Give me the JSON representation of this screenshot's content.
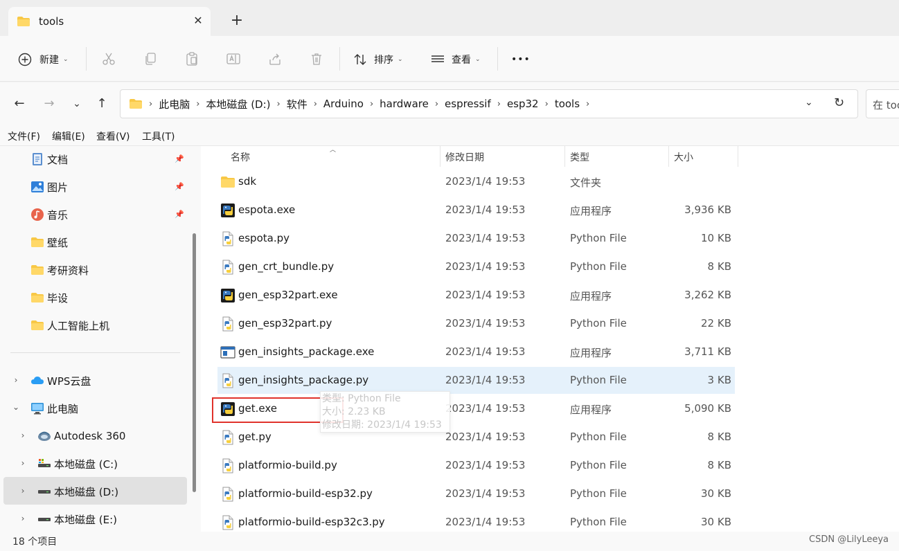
{
  "tab": {
    "title": "tools"
  },
  "toolbar": {
    "new_label": "新建",
    "sort_label": "排序",
    "view_label": "查看",
    "more_label": "•••"
  },
  "address": {
    "crumbs": [
      "此电脑",
      "本地磁盘 (D:)",
      "软件",
      "Arduino",
      "hardware",
      "espressif",
      "esp32",
      "tools"
    ],
    "search_placeholder": "在 tools"
  },
  "menubar": [
    "文件(F)",
    "编辑(E)",
    "查看(V)",
    "工具(T)"
  ],
  "sidebar": {
    "quick": [
      {
        "label": "文档",
        "icon": "document-icon",
        "pinned": true
      },
      {
        "label": "图片",
        "icon": "picture-icon",
        "pinned": true
      },
      {
        "label": "音乐",
        "icon": "music-icon",
        "pinned": true
      },
      {
        "label": "壁纸",
        "icon": "folder-icon",
        "pinned": false
      },
      {
        "label": "考研资料",
        "icon": "folder-icon",
        "pinned": false
      },
      {
        "label": "毕设",
        "icon": "folder-icon",
        "pinned": false
      },
      {
        "label": "人工智能上机",
        "icon": "folder-icon",
        "pinned": false
      }
    ],
    "tree": [
      {
        "label": "WPS云盘",
        "icon": "cloud-icon",
        "expanded": false
      },
      {
        "label": "此电脑",
        "icon": "computer-icon",
        "expanded": true
      },
      {
        "label": "Autodesk 360",
        "icon": "autodesk-icon",
        "expanded": false
      },
      {
        "label": "本地磁盘 (C:)",
        "icon": "drive-icon",
        "expanded": false
      },
      {
        "label": "本地磁盘 (D:)",
        "icon": "drive-icon",
        "expanded": false,
        "selected": true
      },
      {
        "label": "本地磁盘 (E:)",
        "icon": "drive-icon",
        "expanded": false
      }
    ]
  },
  "columns": {
    "name": "名称",
    "date": "修改日期",
    "type": "类型",
    "size": "大小"
  },
  "files": [
    {
      "name": "sdk",
      "date": "2023/1/4 19:53",
      "type": "文件夹",
      "size": "",
      "icon": "folder-icon"
    },
    {
      "name": "espota.exe",
      "date": "2023/1/4 19:53",
      "type": "应用程序",
      "size": "3,936 KB",
      "icon": "python-exe-icon"
    },
    {
      "name": "espota.py",
      "date": "2023/1/4 19:53",
      "type": "Python File",
      "size": "10 KB",
      "icon": "python-file-icon"
    },
    {
      "name": "gen_crt_bundle.py",
      "date": "2023/1/4 19:53",
      "type": "Python File",
      "size": "8 KB",
      "icon": "python-file-icon"
    },
    {
      "name": "gen_esp32part.exe",
      "date": "2023/1/4 19:53",
      "type": "应用程序",
      "size": "3,262 KB",
      "icon": "python-exe-icon"
    },
    {
      "name": "gen_esp32part.py",
      "date": "2023/1/4 19:53",
      "type": "Python File",
      "size": "22 KB",
      "icon": "python-file-icon"
    },
    {
      "name": "gen_insights_package.exe",
      "date": "2023/1/4 19:53",
      "type": "应用程序",
      "size": "3,711 KB",
      "icon": "app-window-icon"
    },
    {
      "name": "gen_insights_package.py",
      "date": "2023/1/4 19:53",
      "type": "Python File",
      "size": "3 KB",
      "icon": "python-file-icon",
      "hover": true
    },
    {
      "name": "get.exe",
      "date": "2023/1/4 19:53",
      "type": "应用程序",
      "size": "5,090 KB",
      "icon": "python-exe-icon",
      "highlighted": true
    },
    {
      "name": "get.py",
      "date": "2023/1/4 19:53",
      "type": "Python File",
      "size": "8 KB",
      "icon": "python-file-icon"
    },
    {
      "name": "platformio-build.py",
      "date": "2023/1/4 19:53",
      "type": "Python File",
      "size": "8 KB",
      "icon": "python-file-icon"
    },
    {
      "name": "platformio-build-esp32.py",
      "date": "2023/1/4 19:53",
      "type": "Python File",
      "size": "30 KB",
      "icon": "python-file-icon"
    },
    {
      "name": "platformio-build-esp32c3.py",
      "date": "2023/1/4 19:53",
      "type": "Python File",
      "size": "30 KB",
      "icon": "python-file-icon"
    }
  ],
  "tooltip": {
    "line1": "类型: Python File",
    "line2": "大小: 2.23 KB",
    "line3": "修改日期: 2023/1/4 19:53"
  },
  "status": {
    "count": "18 个项目"
  },
  "watermark": "CSDN @LilyLeeya",
  "colors": {
    "accent": "#0067c0",
    "highlight_border": "#e0322b",
    "hover_row": "#e5f1fb",
    "folder": "#f8c846"
  }
}
